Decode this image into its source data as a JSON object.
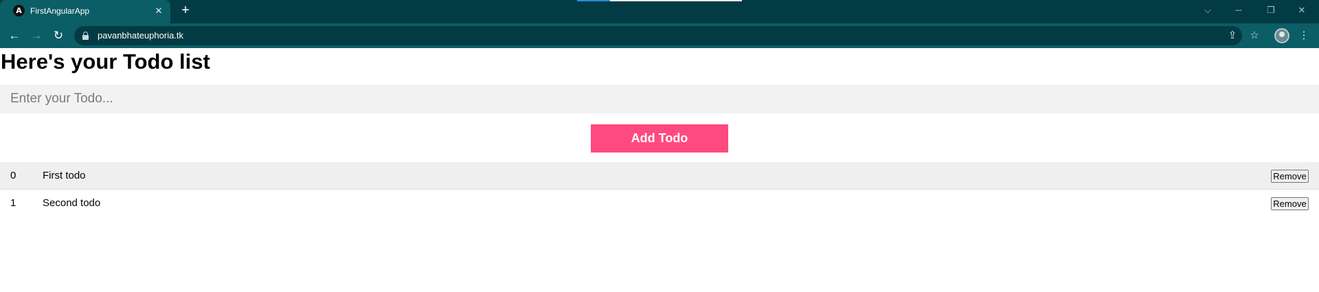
{
  "browser": {
    "tab_title": "FirstAngularApp",
    "tab_favicon_letter": "A",
    "new_tab_symbol": "+",
    "close_symbol": "✕",
    "url": "pavanbhateuphoria.tk",
    "colors": {
      "tabstrip": "#033b44",
      "toolbar": "#0b5d66"
    }
  },
  "page": {
    "title": "Here's your Todo list",
    "input_placeholder": "Enter your Todo...",
    "add_button_label": "Add Todo",
    "accent_color": "#ff4a80"
  },
  "todos": [
    {
      "index": "0",
      "text": "First todo",
      "remove_label": "Remove"
    },
    {
      "index": "1",
      "text": "Second todo",
      "remove_label": "Remove"
    }
  ]
}
